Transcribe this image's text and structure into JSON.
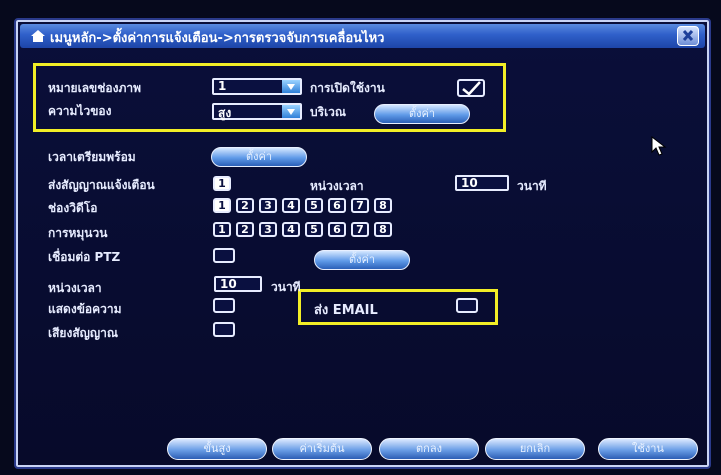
{
  "title": "เมนูหลัก->ตั้งค่าการแจ้งเตือน->การตรวจจับการเคลื่อนไหว",
  "channel": {
    "label": "หมายเลขช่องภาพ",
    "value": "1"
  },
  "enable": {
    "label": "การเปิดใช้งาน",
    "checked": true
  },
  "sensitivity": {
    "label": "ความไวของ",
    "value": "สูง"
  },
  "region": {
    "label": "บริเวณ",
    "button": "ตั้งค่า"
  },
  "schedule": {
    "label": "เวลาเตรียมพร้อม",
    "button": "ตั้งค่า"
  },
  "alarm_out": {
    "label": "ส่งสัญญาณแจ้งเตือน",
    "value": "1",
    "delay_label": "หน่วงเวลา",
    "delay_value": "10",
    "unit": "วนาที"
  },
  "record_channel": {
    "label": "ช่องวิดีโอ",
    "numbers": [
      "1",
      "2",
      "3",
      "4",
      "5",
      "6",
      "7",
      "8"
    ]
  },
  "tour": {
    "label": "การหมุนวน",
    "numbers": [
      "1",
      "2",
      "3",
      "4",
      "5",
      "6",
      "7",
      "8"
    ]
  },
  "ptz": {
    "label": "เชื่อมต่อ PTZ",
    "button": "ตั้งค่า"
  },
  "delay": {
    "label": "หน่วงเวลา",
    "value": "10",
    "unit": "วนาที"
  },
  "show_message": {
    "label": "แสดงข้อความ"
  },
  "send_email": {
    "label": "ส่ง EMAIL"
  },
  "buzzer": {
    "label": "เสียงสัญญาณ"
  },
  "buttons": {
    "advanced": "ขั้นสูง",
    "default": "ค่าเริ่มต้น",
    "ok": "ตกลง",
    "cancel": "ยกเลิก",
    "apply": "ใช้งาน"
  },
  "colors": {
    "highlight": "#f2ee26",
    "title_bar": "#2f5fc9",
    "panel": "#0a0f3a"
  },
  "icons": [
    "home-icon",
    "close-icon",
    "dropdown-arrow-icon",
    "checkmark-icon",
    "mouse-cursor-icon"
  ]
}
